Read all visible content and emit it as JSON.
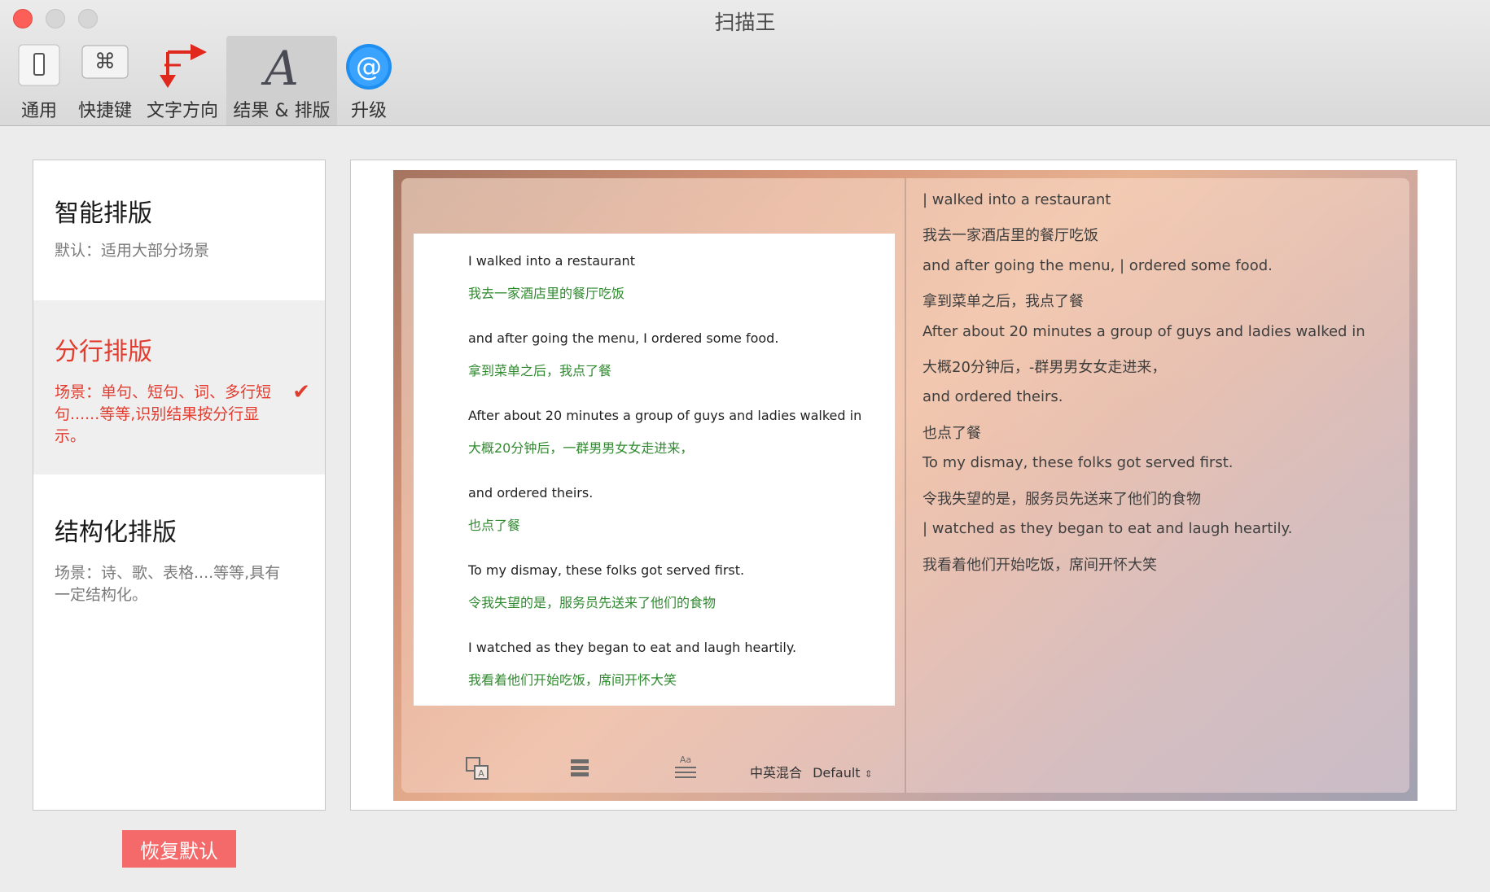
{
  "window": {
    "title": "扫描王"
  },
  "toolbar": {
    "items": [
      {
        "label": "通用",
        "icon": "phone-icon"
      },
      {
        "label": "快捷键",
        "icon": "command-key-icon"
      },
      {
        "label": "文字方向",
        "icon": "text-direction-arrows-icon"
      },
      {
        "label": "结果 & 排版",
        "icon": "font-a-icon",
        "active": true
      },
      {
        "label": "升级",
        "icon": "at-sign-icon"
      }
    ]
  },
  "layouts": [
    {
      "title": "智能排版",
      "desc": "默认：适用大部分场景"
    },
    {
      "title": "分行排版",
      "desc": "场景：单句、短句、词、多行短句......等等,识别结果按分行显示。",
      "selected": true
    },
    {
      "title": "结构化排版",
      "desc": "场景：诗、歌、表格....等等,具有一定结构化。"
    }
  ],
  "restore_label": "恢复默认",
  "preview": {
    "pairs": [
      {
        "en": "I walked into a restaurant",
        "zh": "我去一家酒店里的餐厅吃饭"
      },
      {
        "en": "and after going the menu, I ordered some food.",
        "zh": "拿到菜单之后，我点了餐"
      },
      {
        "en": "After about 20 minutes a group of guys and ladies walked in",
        "zh": "大概20分钟后，一群男男女女走进来，"
      },
      {
        "en": "and ordered theirs.",
        "zh": "也点了餐"
      },
      {
        "en": "To my dismay, these folks got served first.",
        "zh": "令我失望的是，服务员先送来了他们的食物"
      },
      {
        "en": "I watched as they began to eat and laugh heartily.",
        "zh": "我看着他们开始吃饭，席间开怀大笑"
      }
    ],
    "right_lines": [
      "| walked into a restaurant",
      "我去一家酒店里的餐厅吃饭",
      "and after going the menu, | ordered some food.",
      "拿到菜单之后，我点了餐",
      "After about 20 minutes a group of guys and ladies walked in",
      "大概20分钟后，-群男男女女走进来，",
      "and ordered theirs.",
      "也点了餐",
      "To my dismay, these folks got served first.",
      "令我失望的是，服务员先送来了他们的食物",
      "| watched as they began to eat and laugh heartily.",
      "我看着他们开始吃饭，席间开怀大笑"
    ],
    "mode_label": "中英混合",
    "mode_value": "Default"
  },
  "colors": {
    "accent_red": "#e23c2f",
    "restore_bg": "#f46a6a",
    "zh_green": "#2f8a2f"
  }
}
